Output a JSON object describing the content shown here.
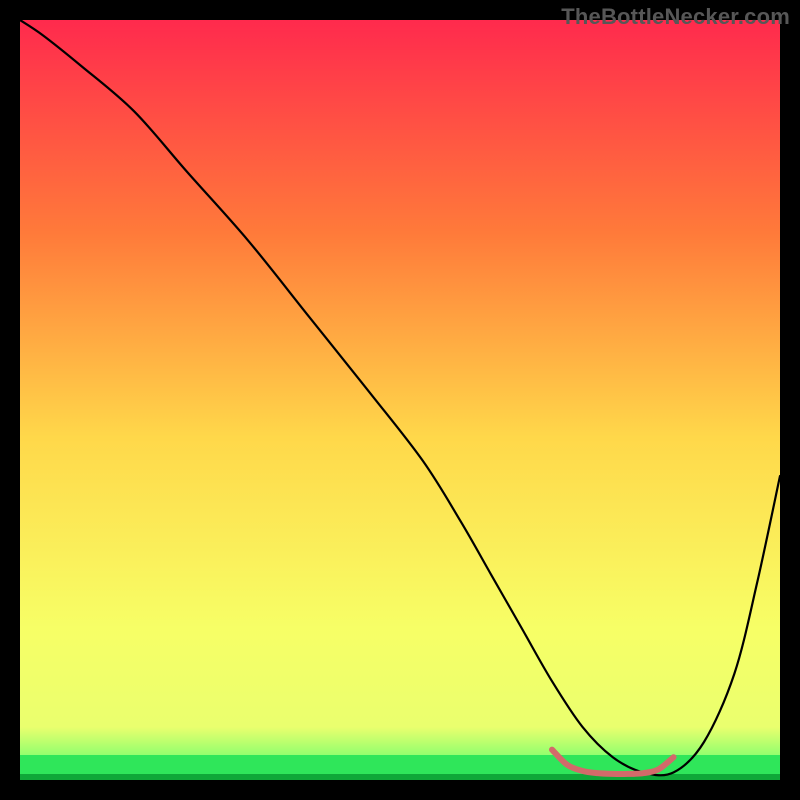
{
  "watermark": "TheBottleNecker.com",
  "chart_data": {
    "type": "line",
    "title": "",
    "xlabel": "",
    "ylabel": "",
    "xlim": [
      0,
      100
    ],
    "ylim": [
      0,
      100
    ],
    "background_gradient": {
      "top": "#ff2a4d",
      "mid_upper": "#ff7a3a",
      "mid": "#ffd84a",
      "mid_lower": "#f7ff66",
      "bottom_band": "#2fe65a",
      "bottom_edge": "#17c943"
    },
    "series": [
      {
        "name": "bottleneck-curve",
        "stroke": "#000000",
        "stroke_width": 2.2,
        "x": [
          0,
          3,
          8,
          15,
          22,
          30,
          38,
          46,
          53,
          58,
          62,
          66,
          70,
          74,
          78,
          82,
          86,
          90,
          94,
          97,
          100
        ],
        "values": [
          100,
          98,
          94,
          88,
          80,
          71,
          61,
          51,
          42,
          34,
          27,
          20,
          13,
          7,
          3,
          1,
          1,
          5,
          14,
          26,
          40
        ]
      },
      {
        "name": "optimal-range-marker",
        "stroke": "#d36a6a",
        "stroke_width": 6,
        "x": [
          70,
          72,
          74,
          76,
          78,
          80,
          82,
          84,
          86
        ],
        "values": [
          4,
          2,
          1.2,
          0.9,
          0.8,
          0.8,
          0.9,
          1.4,
          3
        ]
      }
    ],
    "note": "y-axis inverted visually: 0 at bottom (green), 100 at top (red)"
  }
}
